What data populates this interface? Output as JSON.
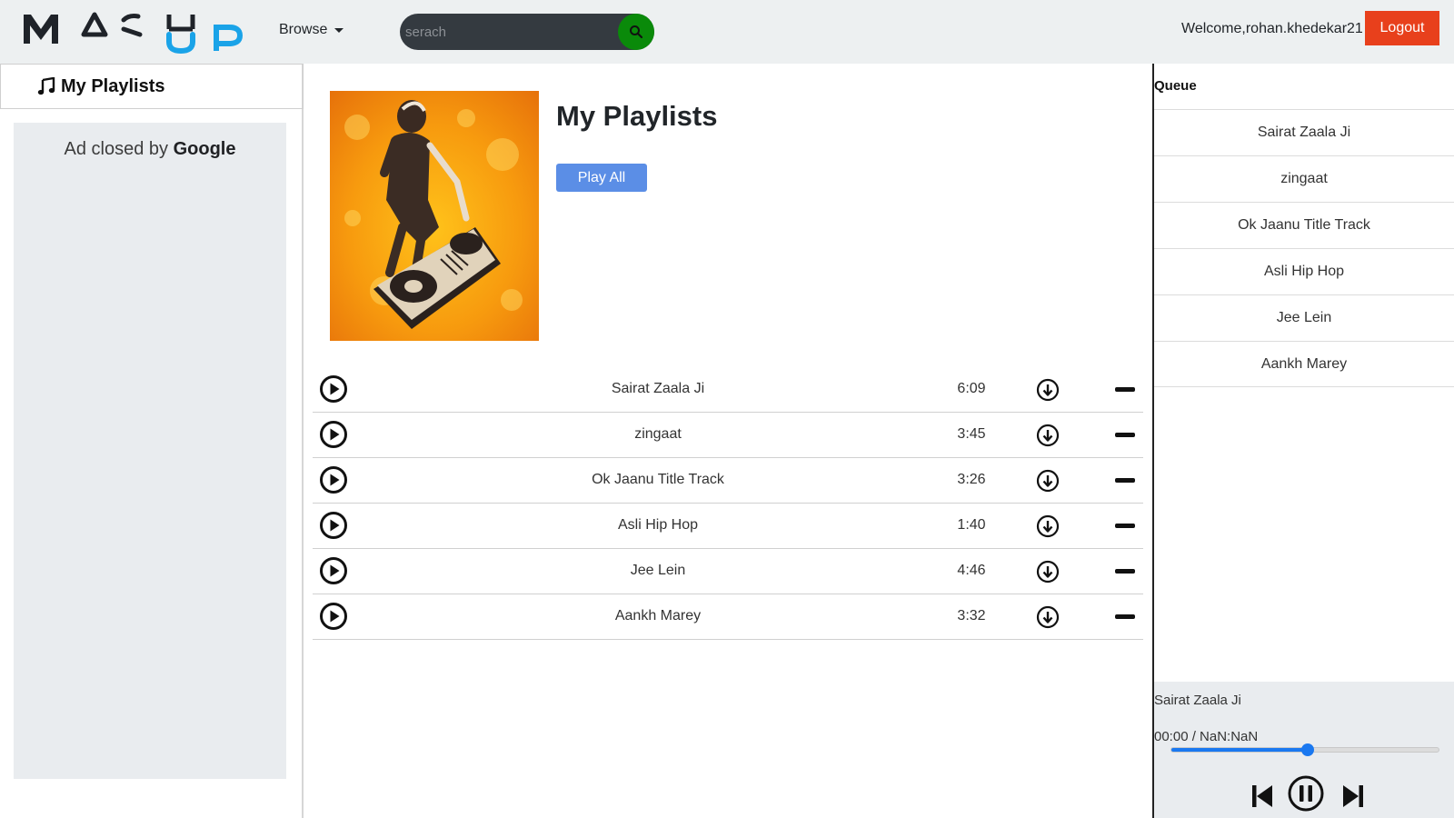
{
  "app": {
    "logo_text": "MASHUP",
    "logo_colors": {
      "dark": "#1f2329",
      "blue": "#1aa3e8"
    }
  },
  "navbar": {
    "browse_label": "Browse",
    "search": {
      "placeholder": "serach",
      "value": ""
    },
    "welcome_text": "Welcome,rohan.khedekar21",
    "logout_label": "Logout",
    "colors": {
      "logout_bg": "#e8401c",
      "search_button_bg": "#0a8a0a"
    }
  },
  "sidebar": {
    "heading": "My Playlists",
    "ad_text_prefix": "Ad closed by ",
    "ad_text_brand": "Google"
  },
  "playlist": {
    "title": "My Playlists",
    "play_all_label": "Play All",
    "tracks": [
      {
        "name": "Sairat Zaala Ji",
        "duration": "6:09"
      },
      {
        "name": "zingaat",
        "duration": "3:45"
      },
      {
        "name": "Ok Jaanu Title Track",
        "duration": "3:26"
      },
      {
        "name": "Asli Hip Hop",
        "duration": "1:40"
      },
      {
        "name": "Jee Lein",
        "duration": "4:46"
      },
      {
        "name": "Aankh Marey",
        "duration": "3:32"
      }
    ]
  },
  "queue": {
    "title": "Queue",
    "items": [
      "Sairat Zaala Ji",
      "zingaat",
      "Ok Jaanu Title Track",
      "Asli Hip Hop",
      "Jee Lein",
      "Aankh Marey"
    ]
  },
  "player": {
    "now_playing": "Sairat Zaala Ji",
    "time_display": "00:00 / NaN:NaN",
    "progress_fraction": 0.51,
    "accent_color": "#1a78f0"
  }
}
